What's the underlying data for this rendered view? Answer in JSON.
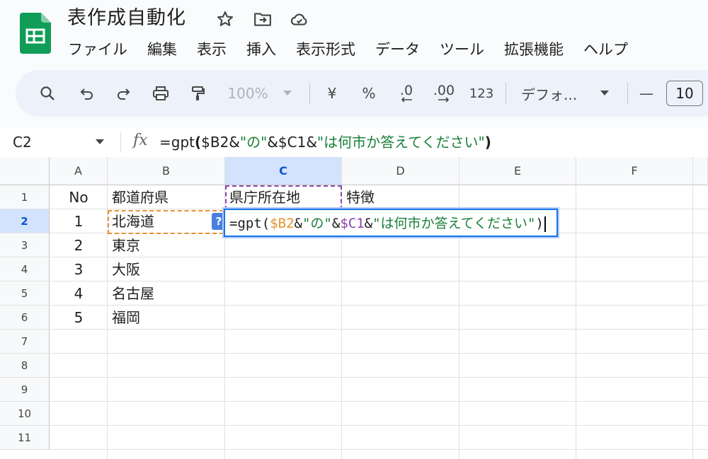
{
  "app": {
    "title": "表作成自動化"
  },
  "menu": [
    "ファイル",
    "編集",
    "表示",
    "挿入",
    "表示形式",
    "データ",
    "ツール",
    "拡張機能",
    "ヘルプ"
  ],
  "toolbar": {
    "zoom": "100%",
    "currency": "¥",
    "percent": "%",
    "dec_decrease": ".0",
    "dec_increase": ".00",
    "number_format": "123",
    "font": "デフォ...",
    "font_size_minus": "—",
    "font_size": "10"
  },
  "formula_bar": {
    "name_box": "C2",
    "fx": "fx",
    "prefix": "=gpt",
    "open": "(",
    "part1": "$B2&",
    "str1": "\"の\"",
    "part2": "&$C1&",
    "str2": "\"は何市か答えてください\"",
    "close": ")"
  },
  "columns": [
    "A",
    "B",
    "C",
    "D",
    "E",
    "F"
  ],
  "rows": [
    "1",
    "2",
    "3",
    "4",
    "5",
    "6",
    "7",
    "8",
    "9",
    "10",
    "11"
  ],
  "cells": {
    "A1": "No",
    "B1": "都道府県",
    "C1": "県庁所在地",
    "D1": "特徴",
    "A2": "1",
    "B2": "北海道",
    "A3": "2",
    "B3": "東京",
    "A4": "3",
    "B4": "大阪",
    "A5": "4",
    "B5": "名古屋",
    "A6": "5",
    "B6": "福岡"
  },
  "editor": {
    "help": "?",
    "t1": "=gpt(",
    "t2": "$B2",
    "t3": "&",
    "t4": "\"の\"",
    "t5": "&",
    "t6": "$C1",
    "t7": "&",
    "t8": "\"は何市か答えてください\"",
    "t9": ")"
  },
  "colors": {
    "accent": "#1a73e8",
    "ref_b2": "#e8912d",
    "ref_c1": "#8e44ad",
    "string": "#188038",
    "sheets_green": "#0f9d58"
  },
  "icons": [
    "sheets-logo-icon",
    "star-icon",
    "move-folder-icon",
    "cloud-status-icon",
    "search-icon",
    "undo-icon",
    "redo-icon",
    "print-icon",
    "paint-format-icon"
  ]
}
